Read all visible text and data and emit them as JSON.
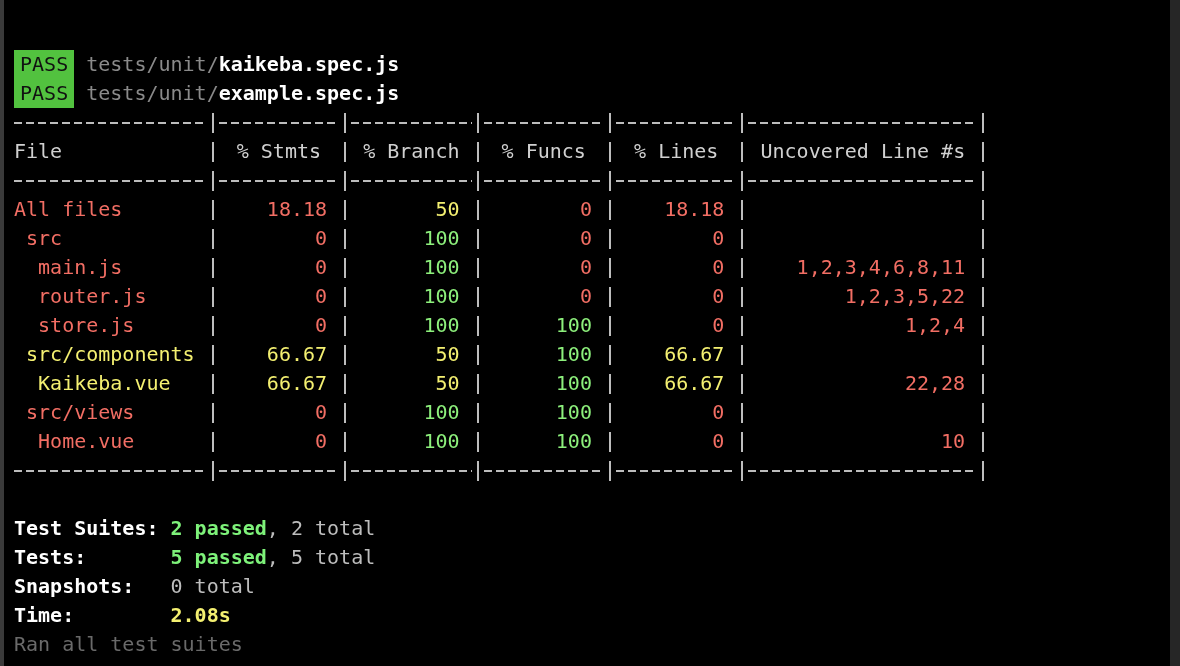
{
  "test_files": [
    {
      "status": "PASS",
      "path": "tests/unit/**kaikeba.spec.js**"
    },
    {
      "status": "PASS",
      "path": "tests/unit/**example.spec.js**"
    }
  ],
  "coverage_table": {
    "columns": [
      "File",
      "% Stmts",
      "% Branch",
      "% Funcs",
      "% Lines",
      "Uncovered Line #s"
    ],
    "rows": [
      {
        "file": "All files",
        "color": "#f26e64",
        "stmts": {
          "value": "18.18",
          "color": "#f26e64"
        },
        "branch": {
          "value": "50",
          "color": "#f4f071"
        },
        "funcs": {
          "value": "0",
          "color": "#f26e64"
        },
        "lines": {
          "value": "18.18",
          "color": "#f26e64"
        },
        "children": [
          {
            "file": "src",
            "color": "#f26e64",
            "stmts": {
              "value": "0",
              "color": "#f26e64"
            },
            "branch": {
              "value": "100",
              "color": "#8df07c"
            },
            "funcs": {
              "value": "0",
              "color": "#f26e64"
            },
            "lines": {
              "value": "0",
              "color": "#f26e64"
            },
            "children": [
              {
                "file": "main.js",
                "color": "#f26e64",
                "stmts": {
                  "value": "0",
                  "color": "#f26e64"
                },
                "branch": {
                  "value": "100",
                  "color": "#8df07c"
                },
                "funcs": {
                  "value": "0",
                  "color": "#f26e64"
                },
                "lines": {
                  "value": "0",
                  "color": "#f26e64"
                },
                "uncovered": "1,2,3,4,6,8,11"
              },
              {
                "file": "router.js",
                "color": "#f26e64",
                "stmts": {
                  "value": "0",
                  "color": "#f26e64"
                },
                "branch": {
                  "value": "100",
                  "color": "#8df07c"
                },
                "funcs": {
                  "value": "0",
                  "color": "#f26e64"
                },
                "lines": {
                  "value": "0",
                  "color": "#f26e64"
                },
                "uncovered": "1,2,3,5,22"
              },
              {
                "file": "store.js",
                "color": "#f26e64",
                "stmts": {
                  "value": "0",
                  "color": "#f26e64"
                },
                "branch": {
                  "value": "100",
                  "color": "#8df07c"
                },
                "funcs": {
                  "value": "100",
                  "color": "#8df07c"
                },
                "lines": {
                  "value": "0",
                  "color": "#f26e64"
                },
                "uncovered": "1,2,4"
              }
            ]
          },
          {
            "file": "src/components",
            "color": "#f4f071",
            "stmts": {
              "value": "66.67",
              "color": "#f4f071"
            },
            "branch": {
              "value": "50",
              "color": "#f4f071"
            },
            "funcs": {
              "value": "100",
              "color": "#8df07c"
            },
            "lines": {
              "value": "66.67",
              "color": "#f4f071"
            },
            "children": [
              {
                "file": "Kaikeba.vue",
                "color": "#f4f071",
                "stmts": {
                  "value": "66.67",
                  "color": "#f4f071"
                },
                "branch": {
                  "value": "50",
                  "color": "#f4f071"
                },
                "funcs": {
                  "value": "100",
                  "color": "#8df07c"
                },
                "lines": {
                  "value": "66.67",
                  "color": "#f4f071"
                },
                "uncovered": "22,28"
              }
            ]
          },
          {
            "file": "src/views",
            "color": "#f26e64",
            "stmts": {
              "value": "0",
              "color": "#f26e64"
            },
            "branch": {
              "value": "100",
              "color": "#8df07c"
            },
            "funcs": {
              "value": "100",
              "color": "#8df07c"
            },
            "lines": {
              "value": "0",
              "color": "#f26e64"
            },
            "children": [
              {
                "file": "Home.vue",
                "color": "#f26e64",
                "stmts": {
                  "value": "0",
                  "color": "#f26e64"
                },
                "branch": {
                  "value": "100",
                  "color": "#8df07c"
                },
                "funcs": {
                  "value": "100",
                  "color": "#8df07c"
                },
                "lines": {
                  "value": "0",
                  "color": "#f26e64"
                },
                "uncovered": "10"
              }
            ]
          }
        ]
      }
    ]
  },
  "summary": [
    {
      "label": "Test Suites:",
      "value": "**2 passed**, 2 total",
      "kind": "result"
    },
    {
      "label": "Tests:",
      "value": "**5 passed**, 5 total",
      "kind": "result"
    },
    {
      "label": "Snapshots:",
      "value": "0 total",
      "kind": "count"
    },
    {
      "label": "Time:",
      "value": "2.08s",
      "kind": "time"
    }
  ],
  "footer": "Ran all test suites"
}
